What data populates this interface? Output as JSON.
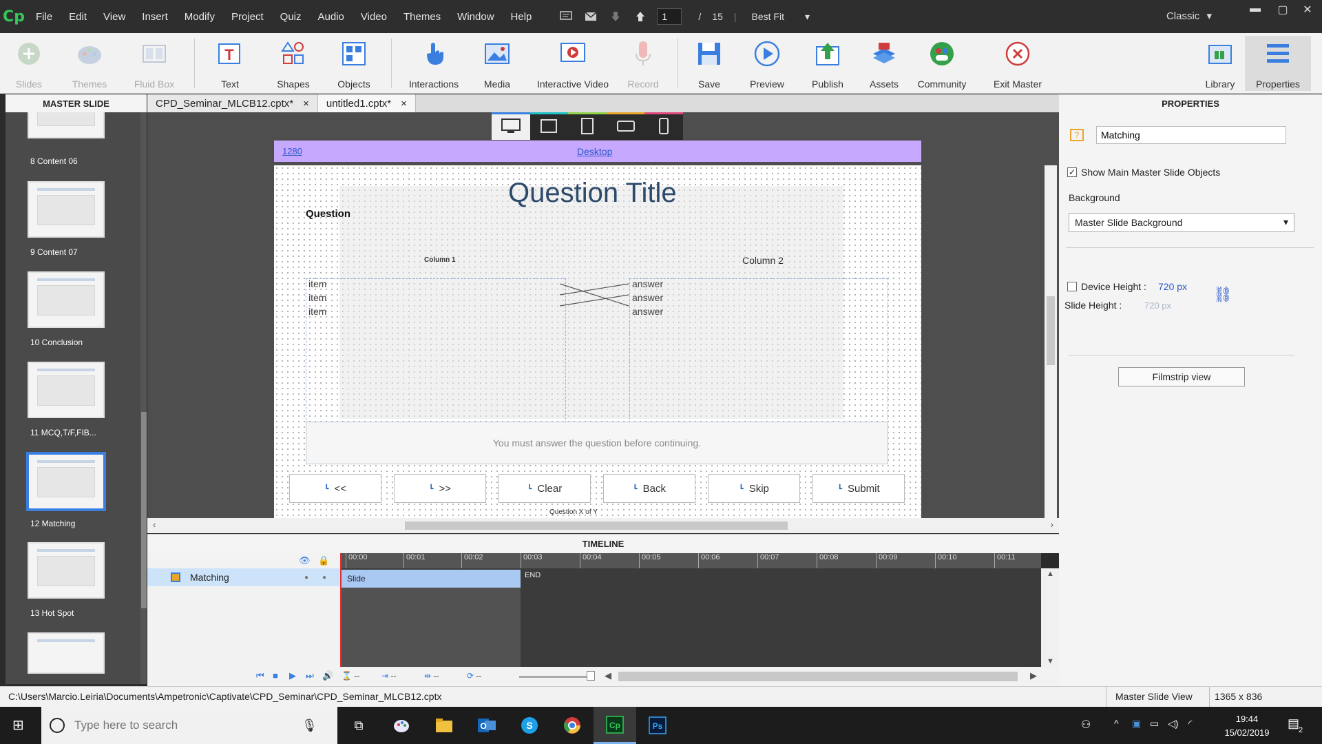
{
  "menubar": {
    "app_logo": "Cp",
    "items": [
      "File",
      "Edit",
      "View",
      "Insert",
      "Modify",
      "Project",
      "Quiz",
      "Audio",
      "Video",
      "Themes",
      "Window",
      "Help"
    ],
    "page_current": "1",
    "page_sep": "/",
    "page_total": "15",
    "zoom": "Best Fit",
    "workspace": "Classic"
  },
  "toolbar": {
    "tools": [
      {
        "label": "Slides",
        "icon": "add-slide-icon",
        "disabled": true
      },
      {
        "label": "Themes",
        "icon": "palette-icon",
        "disabled": true
      },
      {
        "label": "Fluid Box",
        "icon": "fluid-box-icon",
        "disabled": true
      },
      {
        "label": "Text",
        "icon": "text-icon"
      },
      {
        "label": "Shapes",
        "icon": "shapes-icon"
      },
      {
        "label": "Objects",
        "icon": "objects-icon"
      },
      {
        "label": "Interactions",
        "icon": "hand-pointer-icon"
      },
      {
        "label": "Media",
        "icon": "image-icon"
      },
      {
        "label": "Interactive Video",
        "icon": "video-icon"
      },
      {
        "label": "Record",
        "icon": "microphone-icon",
        "disabled": true
      },
      {
        "label": "Save",
        "icon": "save-icon"
      },
      {
        "label": "Preview",
        "icon": "play-icon"
      },
      {
        "label": "Publish",
        "icon": "publish-icon"
      },
      {
        "label": "Assets",
        "icon": "assets-icon"
      },
      {
        "label": "Community",
        "icon": "community-icon"
      },
      {
        "label": "Exit Master",
        "icon": "exit-icon"
      },
      {
        "label": "Library",
        "icon": "library-icon"
      },
      {
        "label": "Properties",
        "icon": "properties-icon"
      }
    ]
  },
  "left_panel": {
    "title": "MASTER SLIDE",
    "thumbnails": [
      "8 Content 06",
      "9 Content 07",
      "10 Conclusion",
      "11 MCQ,T/F,FIB...",
      "12 Matching",
      "13 Hot Spot"
    ]
  },
  "tabs": [
    {
      "label": "CPD_Seminar_MLCB12.cptx*",
      "close": "×"
    },
    {
      "label": "untitled1.cptx*",
      "close": "×"
    }
  ],
  "stage": {
    "breakpoint_label": "Desktop",
    "breakpoint_width": "1280",
    "slide": {
      "title": "Question Title",
      "question": "Question",
      "column1": "Column 1",
      "column2": "Column 2",
      "items": [
        "item",
        "item",
        "item"
      ],
      "answers": [
        "answer",
        "answer",
        "answer"
      ],
      "feedback": "You must answer the question before continuing.",
      "buttons": [
        "<<",
        ">>",
        "Clear",
        "Back",
        "Skip",
        "Submit"
      ],
      "progress": "Question X of Y"
    }
  },
  "timeline": {
    "title": "TIMELINE",
    "layer": "Matching",
    "ticks": [
      "00:00",
      "00:01",
      "00:02",
      "00:03",
      "00:04",
      "00:05",
      "00:06",
      "00:07",
      "00:08",
      "00:09",
      "00:10",
      "00:11"
    ],
    "slide_bar": "Slide",
    "end": "END",
    "controls": [
      "--",
      "--",
      "--",
      "--"
    ]
  },
  "properties": {
    "title": "PROPERTIES",
    "name": "Matching",
    "show_main_master": "Show Main Master Slide Objects",
    "background_label": "Background",
    "background_value": "Master Slide Background",
    "device_height_label": "Device Height :",
    "device_height": "720 px",
    "slide_height_label": "Slide Height :",
    "slide_height": "720 px",
    "filmstrip_button": "Filmstrip view"
  },
  "statusbar": {
    "path": "C:\\Users\\Marcio.Leiria\\Documents\\Ampetronic\\Captivate\\CPD_Seminar\\CPD_Seminar_MLCB12.cptx",
    "view": "Master Slide View",
    "size": "1365 x 836"
  },
  "taskbar": {
    "search_placeholder": "Type here to search",
    "time": "19:44",
    "date": "15/02/2019",
    "notifications": "2"
  },
  "colors": {
    "accent": "#3a7fe0",
    "breakpoint": "#c7a8ff",
    "title_text": "#2d4a6b",
    "playhead": "#e03030"
  }
}
